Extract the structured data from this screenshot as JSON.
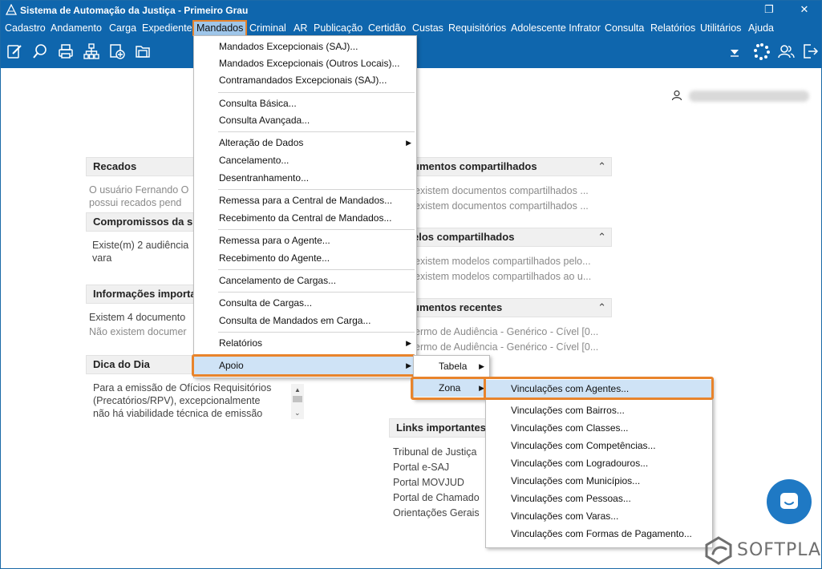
{
  "window": {
    "title": "Sistema de Automação da Justiça - Primeiro Grau",
    "restore_glyph": "❐",
    "close_glyph": "✕"
  },
  "menubar": [
    "Cadastro",
    "Andamento",
    "Carga",
    "Expediente",
    "Mandados",
    "Criminal",
    "AR",
    "Publicação",
    "Certidão",
    "Custas",
    "Requisitórios",
    "Adolescente Infrator",
    "Consulta",
    "Relatórios",
    "Utilitários",
    "Ajuda"
  ],
  "toolbar_icons": [
    "edit-icon",
    "search-icon",
    "printer-icon",
    "hierarchy-icon",
    "add-document-icon",
    "folder-icon"
  ],
  "panels": {
    "recados": {
      "title": "Recados",
      "lines": [
        "O usuário Fernando O",
        "possui recados pend"
      ]
    },
    "compromissos": {
      "title": "Compromissos da s",
      "lines": [
        "Existe(m) 2 audiência",
        "vara"
      ]
    },
    "informacoes": {
      "title": "Informações importa",
      "lines": [
        "Existem 4 documento",
        "Não existem documer"
      ]
    },
    "dica": {
      "title": "Dica do Dia",
      "lines": [
        "Para a emissão de Ofícios Requisitórios",
        "(Precatórios/RPV), excepcionalmente",
        "não há viabilidade técnica de emissão"
      ]
    },
    "documentos": {
      "title": "umentos compartilhados",
      "lines": [
        "existem documentos compartilhados ...",
        "existem documentos compartilhados ..."
      ]
    },
    "modelos": {
      "title": "elos compartilhados",
      "lines": [
        "existem modelos compartilhados pelo...",
        "existem modelos compartilhados ao u..."
      ]
    },
    "recentes": {
      "title": "umentos recentes",
      "lines": [
        "ermo de Audiência - Genérico - Cível [0...",
        "ermo de Audiência - Genérico - Cível [0..."
      ]
    },
    "links": {
      "title": "Links importantes",
      "lines": [
        "Tribunal de Justiça",
        "Portal e-SAJ",
        "Portal MOVJUD",
        "Portal de Chamado",
        "Orientações Gerais"
      ]
    }
  },
  "menu_mandados": {
    "items": [
      "Mandados Excepcionais (SAJ)...",
      "Mandados Excepcionais (Outros Locais)...",
      "Contramandados Excepcionais (SAJ)...",
      "Consulta Básica...",
      "Consulta Avançada...",
      "Alteração de Dados",
      "Cancelamento...",
      "Desentranhamento...",
      "Remessa para a Central de Mandados...",
      "Recebimento da Central de Mandados...",
      "Remessa para o Agente...",
      "Recebimento do Agente...",
      "Cancelamento de Cargas...",
      "Consulta de Cargas...",
      "Consulta de Mandados em Carga...",
      "Relatórios",
      "Apoio"
    ]
  },
  "menu_apoio": {
    "items": [
      "Tabela",
      "Zona"
    ]
  },
  "menu_zona": {
    "items": [
      "Vinculações com Agentes...",
      "Vinculações com Bairros...",
      "Vinculações com Classes...",
      "Vinculações com Competências...",
      "Vinculações com Logradouros...",
      "Vinculações com Municípios...",
      "Vinculações com Pessoas...",
      "Vinculações com Varas...",
      "Vinculações com  Formas de Pagamento..."
    ]
  },
  "brand": {
    "name": "SOFTPLAN"
  },
  "colors": {
    "titlebar": "#0f66ad",
    "highlight": "#e8842c",
    "menu_hover": "#cfe3f6"
  }
}
